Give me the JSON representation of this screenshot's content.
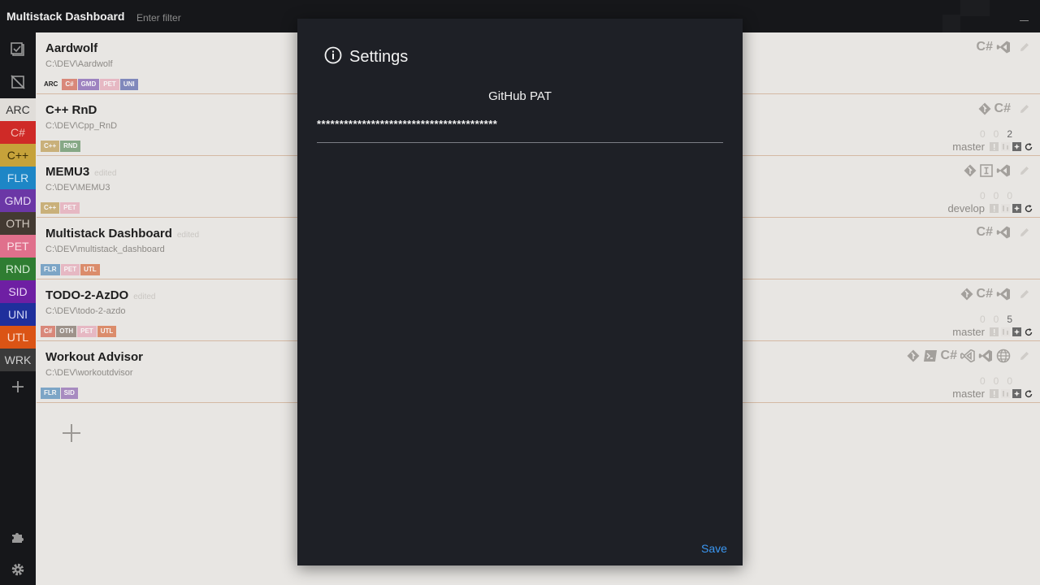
{
  "app": {
    "title": "Multistack Dashboard"
  },
  "filter": {
    "placeholder": "Enter filter"
  },
  "sidebar": {
    "tags": [
      {
        "label": "ARC",
        "color": "#e0ddd9",
        "text_color": "#333333",
        "selected": true
      },
      {
        "label": "C#",
        "color": "#cf2a27",
        "text_color": "#f2c0b8"
      },
      {
        "label": "C++",
        "color": "#c6a23a",
        "text_color": "#3a2d05"
      },
      {
        "label": "FLR",
        "color": "#1d86c6",
        "text_color": "#cfe6f5"
      },
      {
        "label": "GMD",
        "color": "#6b37a6",
        "text_color": "#e6d8f4"
      },
      {
        "label": "OTH",
        "color": "#433a32",
        "text_color": "#cfc6bd"
      },
      {
        "label": "PET",
        "color": "#e0708c",
        "text_color": "#fbe2e8"
      },
      {
        "label": "RND",
        "color": "#2f7d32",
        "text_color": "#d4ecd4"
      },
      {
        "label": "SID",
        "color": "#6e1fa3",
        "text_color": "#ead6f7"
      },
      {
        "label": "UNI",
        "color": "#1f2f9c",
        "text_color": "#d4daf6"
      },
      {
        "label": "UTL",
        "color": "#db5415",
        "text_color": "#fbe0d2"
      },
      {
        "label": "WRK",
        "color": "#3a3a3a",
        "text_color": "#d0d0d0"
      }
    ]
  },
  "chip_colors": {
    "ARC": "transparent",
    "C#": "#d9887a",
    "C++": "#c9b07a",
    "FLR": "#7ca5c6",
    "GMD": "#9e83c0",
    "OTH": "#9d928a",
    "PET": "#e6b8c3",
    "RND": "#86a886",
    "SID": "#a78bc0",
    "UNI": "#8088bb",
    "UTL": "#db8c6b"
  },
  "projects": [
    {
      "name": "Aardwolf",
      "edited": "",
      "path": "C:\\DEV\\Aardwolf",
      "tags": [
        "ARC",
        "C#",
        "GMD",
        "PET",
        "UNI"
      ],
      "icons": [
        "cs",
        "vs",
        "pencil"
      ],
      "counts": [],
      "branch": ""
    },
    {
      "name": "C++ RnD",
      "edited": "",
      "path": "C:\\DEV\\Cpp_RnD",
      "tags": [
        "C++",
        "RND"
      ],
      "icons": [
        "git",
        "cs",
        "pencil"
      ],
      "counts": [
        "0",
        "0",
        "2"
      ],
      "branch": "master"
    },
    {
      "name": "MEMU3",
      "edited": "edited",
      "path": "C:\\DEV\\MEMU3",
      "tags": [
        "C++",
        "PET"
      ],
      "icons": [
        "git",
        "ide",
        "vs",
        "pencil"
      ],
      "counts": [
        "0",
        "0",
        "0"
      ],
      "branch": "develop"
    },
    {
      "name": "Multistack Dashboard",
      "edited": "edited",
      "path": "C:\\DEV\\multistack_dashboard",
      "tags": [
        "FLR",
        "PET",
        "UTL"
      ],
      "icons": [
        "cs",
        "vs",
        "pencil"
      ],
      "counts": [],
      "branch": ""
    },
    {
      "name": "TODO-2-AzDO",
      "edited": "edited",
      "path": "C:\\DEV\\todo-2-azdo",
      "tags": [
        "C#",
        "OTH",
        "PET",
        "UTL"
      ],
      "icons": [
        "git",
        "cs",
        "vs",
        "pencil"
      ],
      "counts": [
        "0",
        "0",
        "5"
      ],
      "branch": "master"
    },
    {
      "name": "Workout Advisor",
      "edited": "",
      "path": "C:\\DEV\\workoutdvisor",
      "tags": [
        "FLR",
        "SID"
      ],
      "icons": [
        "git",
        "terminal",
        "cs",
        "vscode",
        "vs",
        "globe",
        "pencil"
      ],
      "counts": [
        "0",
        "0",
        "0"
      ],
      "branch": "master"
    }
  ],
  "dialog": {
    "title": "Settings",
    "field_label": "GitHub PAT",
    "field_value": "****************************************",
    "save_label": "Save"
  }
}
